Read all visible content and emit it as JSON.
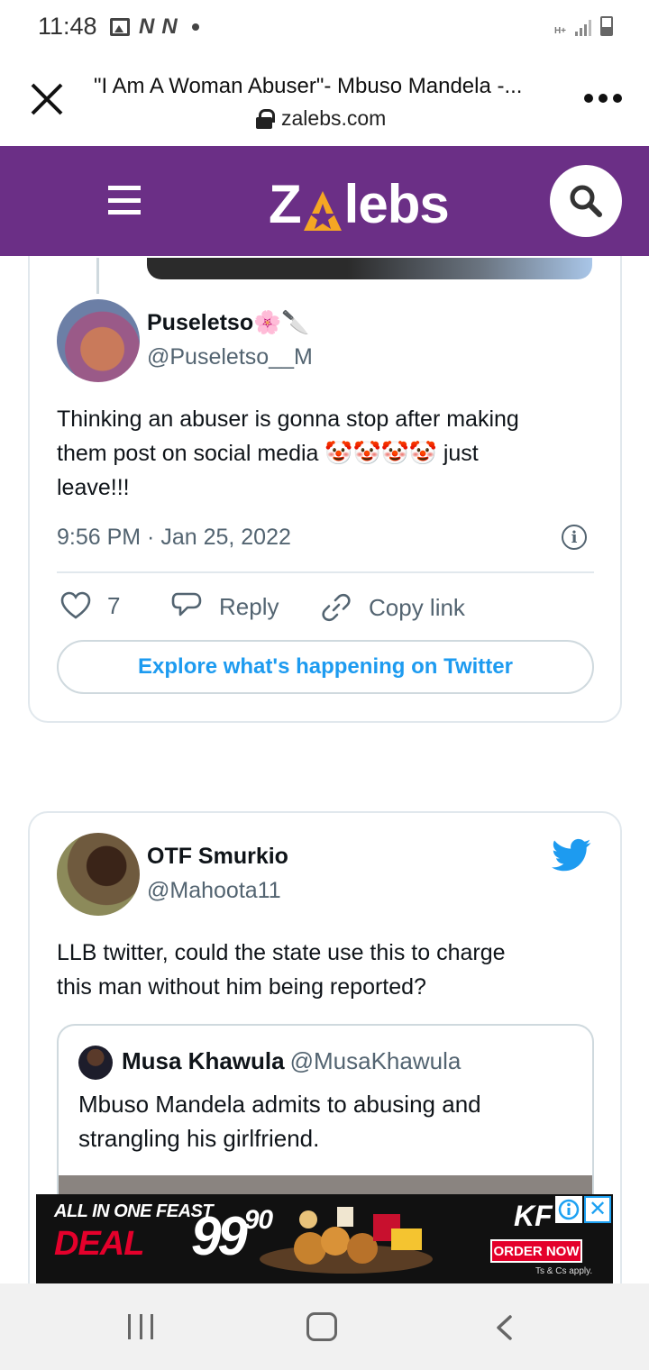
{
  "status_bar": {
    "time": "11:48",
    "network_left_1": "N",
    "network_left_2": "N",
    "signal_label": "H+"
  },
  "browser": {
    "page_title": "\"I Am A Woman Abuser\"- Mbuso Mandela -...",
    "url": "zalebs.com"
  },
  "site": {
    "brand_prefix": "Z",
    "brand_suffix": "lebs",
    "brand_color": "#6b2f86",
    "accent_color": "#f5a623"
  },
  "tweet1": {
    "name": "Puseletso",
    "name_emoji": "🌸🔪",
    "handle": "@Puseletso__M",
    "text_line1": "Thinking an abuser is gonna stop after making",
    "text_line2_a": "them post on social media ",
    "text_line2_emoji": "🤡🤡🤡🤡",
    "text_line2_b": " just",
    "text_line3": "leave!!!",
    "timestamp": "9:56 PM · Jan 25, 2022",
    "likes": "7",
    "reply_label": "Reply",
    "copy_link_label": "Copy link",
    "explore_label": "Explore what's happening on Twitter"
  },
  "tweet2": {
    "name": "OTF Smurkio",
    "handle": "@Mahoota11",
    "text_line1": "LLB twitter, could the state use this to charge",
    "text_line2": "this man without him being reported?",
    "quote": {
      "name": "Musa Khawula",
      "handle": "@MusaKhawula",
      "text_line1": "Mbuso Mandela admits to abusing and",
      "text_line2": "strangling his girlfriend."
    }
  },
  "ad": {
    "line1": "ALL IN ONE FEAST",
    "line2": "DEAL",
    "price_main": "99",
    "price_cents": "90",
    "brand": "KF",
    "cta": "ORDER NOW",
    "terms": "Ts & Cs apply."
  },
  "icons": {
    "close": "close-icon",
    "lock": "lock-icon",
    "more": "more-vertical-icon",
    "menu": "hamburger-icon",
    "search": "search-icon",
    "info": "info-icon",
    "heart": "heart-icon",
    "reply": "reply-icon",
    "link": "link-icon",
    "twitter": "twitter-bird-icon"
  }
}
